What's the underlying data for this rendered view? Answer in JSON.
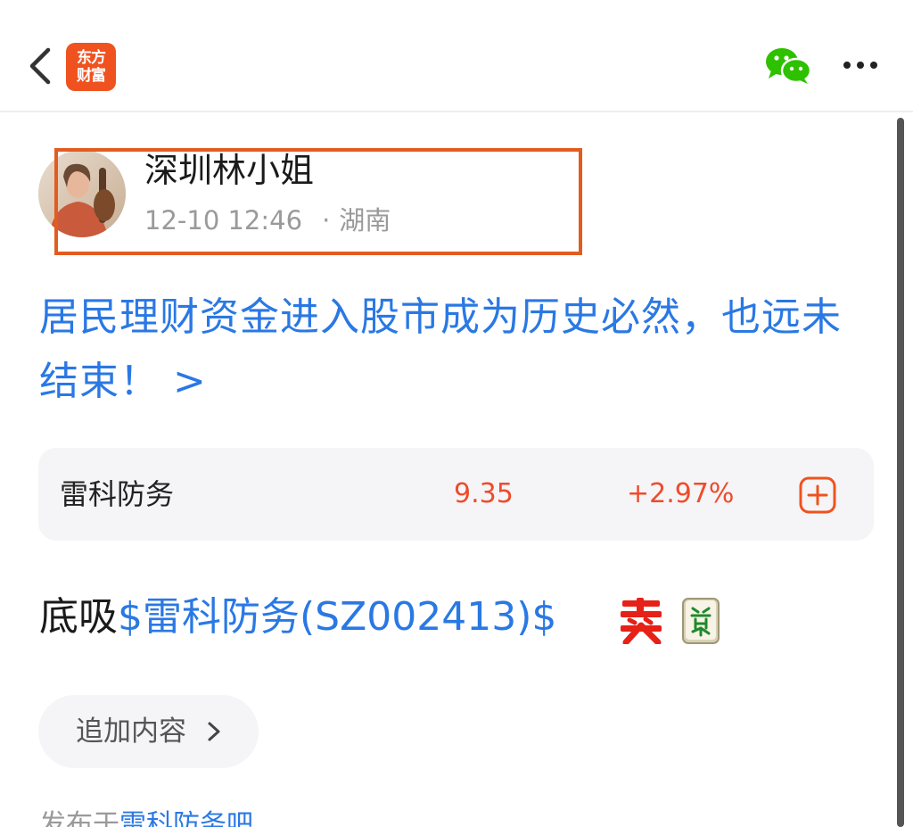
{
  "header": {
    "logo_line1": "东方",
    "logo_line2": "财富",
    "back_icon": "chevron-left-icon",
    "share_icon": "wechat-icon",
    "more_icon": "more-dots-icon"
  },
  "author": {
    "name": "深圳林小姐",
    "date": "12-10 12:46",
    "separator": "·",
    "location": "湖南"
  },
  "post": {
    "title": "居民理财资金进入股市成为历史必然，也远未结束！ >",
    "body_prefix": "底吸",
    "body_stock_link": "$雷科防务(SZ002413)$",
    "emoji_1": "buy-emoji-icon",
    "emoji_2": "fa-tile-emoji-icon"
  },
  "stock_card": {
    "name": "雷科防务",
    "price": "9.35",
    "change": "+2.97%",
    "add_icon": "plus-square-icon"
  },
  "append": {
    "label": "追加内容"
  },
  "footer": {
    "posted_prefix": "发布于",
    "bar_name": "雷科防务吧"
  },
  "colors": {
    "brand_orange": "#f0521f",
    "highlight_box": "#e25c20",
    "link_blue": "#2a78e4",
    "up_red": "#ef4b2b",
    "wechat_green": "#2dc100",
    "card_bg": "#f5f5f7"
  }
}
